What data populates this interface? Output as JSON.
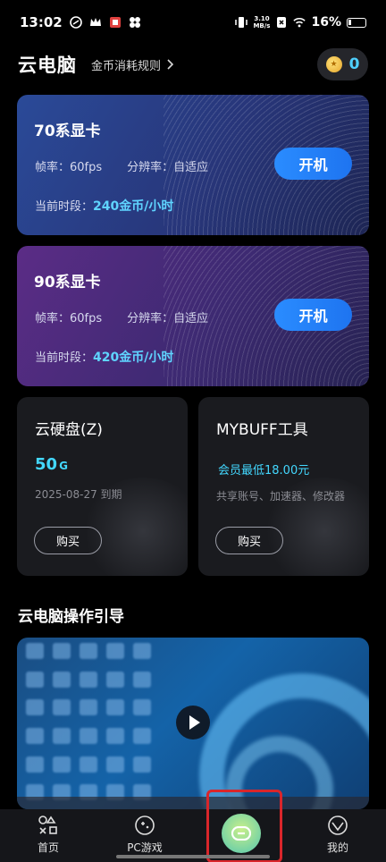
{
  "status_bar": {
    "time": "13:02",
    "net_speed_value": "3.10",
    "net_speed_unit": "MB/s",
    "battery": "16%"
  },
  "header": {
    "title": "云电脑",
    "rules_link": "金币消耗规则",
    "coin_balance": "0"
  },
  "gpu_cards": [
    {
      "name": "70系显卡",
      "fps": "帧率：60fps",
      "resolution": "分辨率：自适应",
      "price_prefix": "当前时段：",
      "price_value": "240金币/小时",
      "button": "开机"
    },
    {
      "name": "90系显卡",
      "fps": "帧率：60fps",
      "resolution": "分辨率：自适应",
      "price_prefix": "当前时段：",
      "price_value": "420金币/小时",
      "button": "开机"
    }
  ],
  "disk_card": {
    "title": "云硬盘(Z)",
    "size_value": "50",
    "size_unit": "G",
    "expire": "2025-08-27 到期",
    "button": "购买"
  },
  "tool_card": {
    "title": "MYBUFF工具",
    "member_price": "会员最低18.00元",
    "features": "共享账号、加速器、修改器",
    "button": "购买"
  },
  "guide": {
    "title": "云电脑操作引导"
  },
  "bottom_nav": {
    "items": [
      {
        "label": "首页",
        "icon": "home-shapes-icon"
      },
      {
        "label": "PC游戏",
        "icon": "gamepad-icon"
      },
      {
        "label": "",
        "icon": "cloud-pc-center-icon"
      },
      {
        "label": "我的",
        "icon": "profile-icon"
      }
    ]
  },
  "colors": {
    "accent_blue": "#2a8cff",
    "price_cyan": "#5fd4ff",
    "highlight_red": "#d9262b"
  }
}
